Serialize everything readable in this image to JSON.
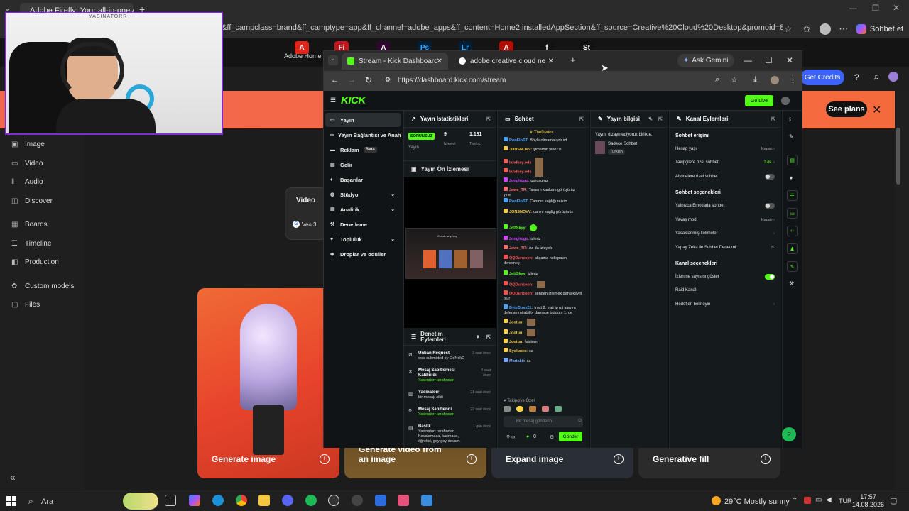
{
  "edge": {
    "tab_title": "Adobe Firefly: Your all-in-one AI c",
    "url": "&ff_campclass=brand&ff_camptype=app&ff_channel=adobe_apps&ff_content=Home2:installedAppSection&ff_source=Creative%20Cloud%20Desktop&promoid=8MVV35QX&x-product...",
    "sohbet_et": "Sohbet et"
  },
  "firefly": {
    "adobe_home": "Adobe Home",
    "get_credits": "Get Credits",
    "see_plans": "See plans",
    "sidebar": [
      {
        "label": "Image",
        "icon": "image-icon"
      },
      {
        "label": "Video",
        "icon": "video-icon"
      },
      {
        "label": "Audio",
        "icon": "audio-icon"
      },
      {
        "label": "Discover",
        "icon": "discover-icon"
      },
      {
        "label": "Boards",
        "icon": "boards-icon"
      },
      {
        "label": "Timeline",
        "icon": "timeline-icon"
      },
      {
        "label": "Production",
        "icon": "production-icon"
      },
      {
        "label": "Custom models",
        "icon": "custom-models-icon"
      },
      {
        "label": "Files",
        "icon": "files-icon"
      }
    ],
    "video_selector": "Video",
    "model_label": "Veo 3",
    "cards": [
      {
        "label": "Generate image"
      },
      {
        "label": "Generate video from an image"
      },
      {
        "label": "Expand image"
      },
      {
        "label": "Generative fill"
      }
    ]
  },
  "webcam": {
    "tag": "YASINATORR"
  },
  "chrome": {
    "tab1": "Stream - Kick Dashboard",
    "tab2": "adobe creative cloud ne kadar",
    "ask_gemini": "Ask Gemini",
    "url": "https://dashboard.kick.com/stream"
  },
  "kick": {
    "logo": "KICK",
    "go_live": "Go Live",
    "nav": [
      {
        "label": "Yayın",
        "icon": "stream-icon"
      },
      {
        "label": "Yayın Bağlantısı ve Anahtarı",
        "icon": "link-icon"
      },
      {
        "label": "Reklam",
        "icon": "ad-icon",
        "badge": "Beta"
      },
      {
        "label": "Gelir",
        "icon": "revenue-icon"
      },
      {
        "label": "Başarılar",
        "icon": "achievements-icon"
      },
      {
        "label": "Stüdyo",
        "icon": "studio-icon",
        "chevron": true
      },
      {
        "label": "Analitik",
        "icon": "analytics-icon",
        "chevron": true
      },
      {
        "label": "Denetleme",
        "icon": "moderation-icon"
      },
      {
        "label": "Topluluk",
        "icon": "community-icon",
        "chevron": true
      },
      {
        "label": "Droplar ve ödüller",
        "icon": "drops-icon"
      }
    ],
    "stats": {
      "title": "Yayın İstatistikleri",
      "status": "SORUNSUZ",
      "status_label": "Yayın",
      "viewers": "9",
      "viewers_label": "İzleyici",
      "followers": "1.181",
      "followers_label": "Takipçi"
    },
    "preview_title": "Yayın Ön İzlemesi",
    "preview_caption": "Create anything",
    "mod_actions_title": "Denetim Eylemleri",
    "mod_actions": [
      {
        "title": "Unban Request",
        "sub": "was submitted by GoNdkC",
        "time": "3 saat önce"
      },
      {
        "title": "Mesaj Sabitlemesi Kaldırıldı",
        "sub": "Yasinatorr tarafından",
        "time": "4 saat önce"
      },
      {
        "title": "Yasinatorr",
        "sub": "bir mesajı sildi",
        "time": "21 saat önce"
      },
      {
        "title": "Mesaj Sabitlendi",
        "sub": "Yasinatorr tarafından",
        "time": "22 saat önce"
      },
      {
        "title": "Başlık",
        "sub": "Yasinatorr tarafından Kovalamaca, kaçmaca, öğretici, goy goy devam.",
        "time": "1 gün önce"
      }
    ],
    "chat": {
      "title": "Sohbet",
      "pinned": "TheDedox",
      "messages": [
        {
          "user": "RonFloST:",
          "text": "Böyle olmamalıydı xd",
          "color": "#4aa3ff"
        },
        {
          "user": "JONSNOVV:",
          "text": "şimardin yine :D",
          "color": "#f2c94c"
        },
        {
          "user": "landkey.ods",
          "text": "",
          "color": "#ff5a5a"
        },
        {
          "user": "landkey.ods",
          "text": "",
          "color": "#ff5a5a"
        },
        {
          "user": "Jonghogo:",
          "text": "gorusuruz",
          "color": "#d046ff"
        },
        {
          "user": "Jawe_TR:",
          "text": "Tamam kankam görüşürüz yine",
          "color": "#ff6b6b"
        },
        {
          "user": "RonFloST:",
          "text": "Canının sağlığı reisim",
          "color": "#4aa3ff"
        },
        {
          "user": "JONSNOVV:",
          "text": "canini saglig görüşürüz",
          "color": "#f2c94c"
        },
        {
          "user": "JettSkyy:",
          "text": "",
          "color": "#53fc18"
        },
        {
          "user": "Jonghogo:",
          "text": "izleriz",
          "color": "#d046ff"
        },
        {
          "user": "Jawe_TR:",
          "text": "Ac da izleyek",
          "color": "#ff6b6b"
        },
        {
          "user": "QQDunzoon:",
          "text": "akşama hellspawn denemeç",
          "color": "#ff4d4d"
        },
        {
          "user": "JettSkyy:",
          "text": "izleriz",
          "color": "#53fc18"
        },
        {
          "user": "QQDunzoon:",
          "text": "",
          "color": "#ff4d4d"
        },
        {
          "user": "QQDunzoon:",
          "text": "senden izlemek daha keyifli olur",
          "color": "#ff4d4d"
        },
        {
          "user": "ByteBoss21:",
          "text": "frost 2. trait ip mi alayım defense mi ability damage buldum 1. de",
          "color": "#4aa3ff"
        },
        {
          "user": "Jootun:",
          "text": "",
          "color": "#ffd24a"
        },
        {
          "user": "Jootun:",
          "text": "",
          "color": "#ffd24a"
        },
        {
          "user": "Jootun:",
          "text": "İsistem",
          "color": "#ffd24a"
        },
        {
          "user": "Syoluxes:",
          "text": "sa",
          "color": "#ffd24a"
        },
        {
          "user": "Martakii:",
          "text": "sa",
          "color": "#7aa2ff"
        }
      ],
      "emote_label": "Takipçiye Özel",
      "input_placeholder": "Bir mesaj gönderin",
      "count": "0",
      "send": "Gönder"
    },
    "info": {
      "title": "Yayın bilgisi",
      "desc": "Yayını dizayn ediyoruz birlikte.",
      "category": "Sadece Sohbet",
      "language": "Turkish"
    },
    "channel": {
      "title": "Kanal Eylemleri",
      "chat_access_h": "Sohbet erişimi",
      "account_age": "Hesap yaşı",
      "account_age_val": "Kapalı",
      "followers_only": "Takipçilere özel sohbet",
      "followers_only_val": "3 dk.",
      "subs_only": "Abonelere özel sohbet",
      "chat_opts_h": "Sohbet seçenekleri",
      "emotes_only": "Yalnızca Emotiarla sohbet",
      "slow_mode": "Yavaş mod",
      "slow_mode_val": "Kapalı",
      "banned_words": "Yasaklanmış kelimeler",
      "ai_mod": "Yapay Zeka ile Sohbet Denetimi",
      "channel_opts_h": "Kanal seçenekleri",
      "show_viewers": "İzlenme sayısını göster",
      "raid": "Raid Kanalı",
      "goals": "Hedefleri belirleyin"
    }
  },
  "taskbar": {
    "search": "Ara",
    "weather": "29°C  Mostly sunny",
    "lang": "TUR",
    "time": "17:57",
    "date": "14.08.2026"
  }
}
